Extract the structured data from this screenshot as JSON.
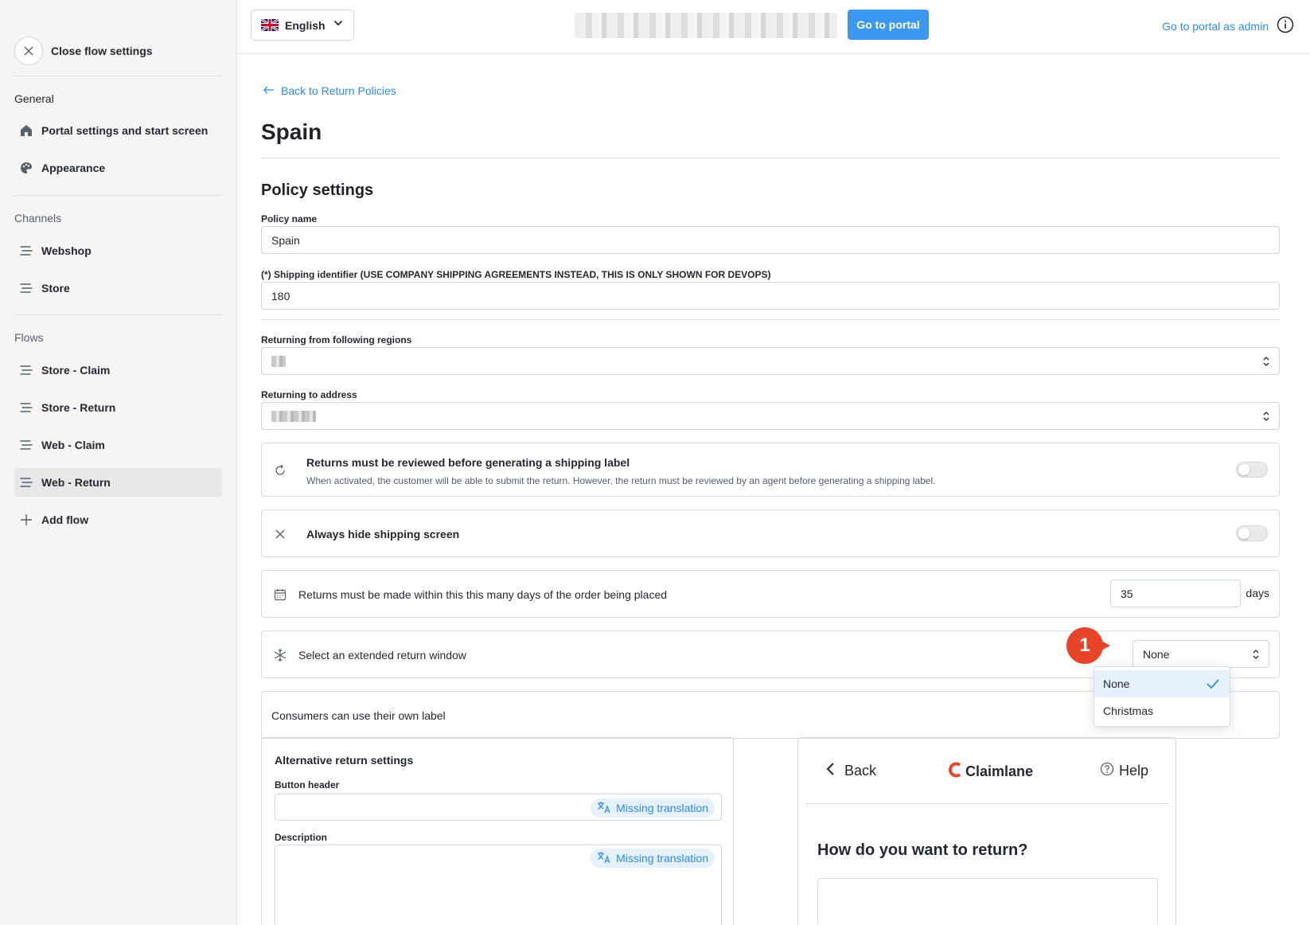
{
  "sidebar": {
    "close_label": "Close flow settings",
    "general_heading": "General",
    "general_items": [
      "Portal settings and start screen",
      "Appearance"
    ],
    "channels_heading": "Channels",
    "channels_items": [
      "Webshop",
      "Store"
    ],
    "flows_heading": "Flows",
    "flows_items": [
      "Store - Claim",
      "Store - Return",
      "Web - Claim",
      "Web - Return"
    ],
    "active_item": "Web - Return",
    "add_flow_label": "Add flow"
  },
  "topbar": {
    "language": "English",
    "go_to_portal": "Go to portal",
    "go_to_portal_admin": "Go to portal as admin"
  },
  "main": {
    "back_link": "Back to Return Policies",
    "page_title": "Spain",
    "section_title": "Policy settings",
    "policy_name_label": "Policy name",
    "policy_name_value": "Spain",
    "shipping_identifier_label": "(*) Shipping identifier (USE COMPANY SHIPPING AGREEMENTS INSTEAD, THIS IS ONLY SHOWN FOR DEVOPS)",
    "shipping_identifier_value": "180",
    "regions_label": "Returning from following regions",
    "address_label": "Returning to address",
    "review_title": "Returns must be reviewed before generating a shipping label",
    "review_desc": "When activated, the customer will be able to submit the return. However, the return must be reviewed by an agent before generating a shipping label.",
    "review_enabled": false,
    "hide_shipping_title": "Always hide shipping screen",
    "hide_shipping_enabled": false,
    "days_text": "Returns must be made within this this many days of the order being placed",
    "days_value": "35",
    "days_unit": "days",
    "extended_text": "Select an extended return window",
    "extended_value": "None",
    "extended_options": [
      "None",
      "Christmas"
    ],
    "own_label_text": "Consumers can use their own label",
    "callout_number": "1"
  },
  "alternative": {
    "title": "Alternative return settings",
    "button_header_label": "Button header",
    "description_label": "Description",
    "missing_translation": "Missing translation"
  },
  "preview": {
    "back": "Back",
    "brand": "Claimlane",
    "help": "Help",
    "question": "How do you want to return?"
  },
  "colors": {
    "accent": "#3b97f0",
    "link": "#2d8ce6",
    "callout": "#e8442a",
    "brand_logo": "#e8442a"
  }
}
